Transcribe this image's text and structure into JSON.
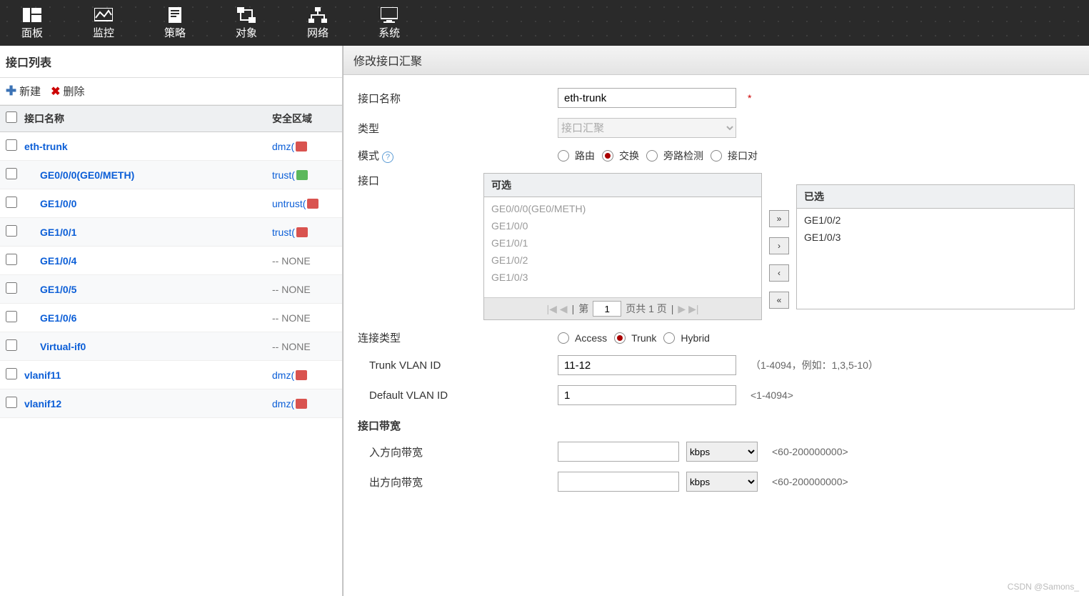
{
  "topnav": [
    {
      "label": "面板",
      "icon": "dashboard"
    },
    {
      "label": "监控",
      "icon": "monitor"
    },
    {
      "label": "策略",
      "icon": "policy"
    },
    {
      "label": "对象",
      "icon": "object"
    },
    {
      "label": "网络",
      "icon": "network"
    },
    {
      "label": "系统",
      "icon": "system"
    }
  ],
  "left": {
    "title": "接口列表",
    "new": "新建",
    "delete": "删除",
    "colName": "接口名称",
    "colZone": "安全区域",
    "rows": [
      {
        "name": "eth-trunk",
        "zone": "dmz(",
        "zoneClass": "red",
        "indent": false
      },
      {
        "name": "GE0/0/0(GE0/METH)",
        "zone": "trust(",
        "zoneClass": "green",
        "indent": true
      },
      {
        "name": "GE1/0/0",
        "zone": "untrust(",
        "zoneClass": "red",
        "indent": true
      },
      {
        "name": "GE1/0/1",
        "zone": "trust(",
        "zoneClass": "red",
        "indent": true
      },
      {
        "name": "GE1/0/4",
        "zone": "-- NONE",
        "zoneClass": "none",
        "indent": true
      },
      {
        "name": "GE1/0/5",
        "zone": "-- NONE",
        "zoneClass": "none",
        "indent": true
      },
      {
        "name": "GE1/0/6",
        "zone": "-- NONE",
        "zoneClass": "none",
        "indent": true
      },
      {
        "name": "Virtual-if0",
        "zone": "-- NONE",
        "zoneClass": "none",
        "indent": true
      },
      {
        "name": "vlanif11",
        "zone": "dmz(",
        "zoneClass": "red",
        "indent": false
      },
      {
        "name": "vlanif12",
        "zone": "dmz(",
        "zoneClass": "red",
        "indent": false
      }
    ]
  },
  "dialog": {
    "title": "修改接口汇聚",
    "nameLabel": "接口名称",
    "nameValue": "eth-trunk",
    "typeLabel": "类型",
    "typeValue": "接口汇聚",
    "modeLabel": "模式",
    "modes": [
      "路由",
      "交换",
      "旁路检测",
      "接口对"
    ],
    "modeSelected": "交换",
    "interfaceLabel": "接口",
    "availHead": "可选",
    "selHead": "已选",
    "available": [
      "GE0/0/0(GE0/METH)",
      "GE1/0/0",
      "GE1/0/1",
      "GE1/0/2",
      "GE1/0/3"
    ],
    "selected": [
      "GE1/0/2",
      "GE1/0/3"
    ],
    "pagerPrefix": "第",
    "pagerPage": "1",
    "pagerSuffix": "页共 1 页",
    "connTypeLabel": "连接类型",
    "connTypes": [
      "Access",
      "Trunk",
      "Hybrid"
    ],
    "connSelected": "Trunk",
    "trunkVlanLabel": "Trunk VLAN ID",
    "trunkVlanValue": "11-12",
    "trunkVlanHint": "（1-4094，例如：1,3,5-10）",
    "defaultVlanLabel": "Default VLAN ID",
    "defaultVlanValue": "1",
    "defaultVlanHint": "<1-4094>",
    "bwSection": "接口带宽",
    "inBwLabel": "入方向带宽",
    "outBwLabel": "出方向带宽",
    "bwUnit": "kbps",
    "bwHint": "<60-200000000>"
  },
  "watermark": "CSDN @Samons_"
}
